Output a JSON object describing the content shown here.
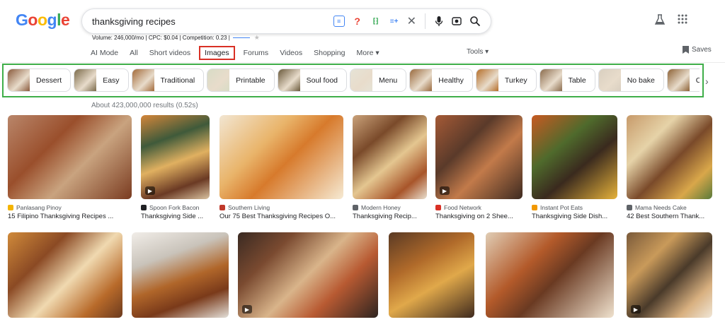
{
  "logo": {
    "letters": [
      "G",
      "o",
      "o",
      "g",
      "l",
      "e"
    ],
    "colors": [
      "#4285F4",
      "#EA4335",
      "#FBBC05",
      "#4285F4",
      "#34A853",
      "#EA4335"
    ]
  },
  "search": {
    "query": "thanksgiving recipes"
  },
  "seo": {
    "text": "Volume: 246,000/mo | CPC: $0.04 | Competition: 0.23 |"
  },
  "tabs": [
    {
      "label": "AI Mode"
    },
    {
      "label": "All"
    },
    {
      "label": "Short videos"
    },
    {
      "label": "Images",
      "active": true
    },
    {
      "label": "Forums"
    },
    {
      "label": "Videos"
    },
    {
      "label": "Shopping"
    },
    {
      "label": "More ▾"
    }
  ],
  "tools_label": "Tools ▾",
  "saves_label": "Saves",
  "chips": [
    {
      "label": "Dessert",
      "color": "#8a5a3c"
    },
    {
      "label": "Easy",
      "color": "#7b6a4a"
    },
    {
      "label": "Traditional",
      "color": "#a36a3a"
    },
    {
      "label": "Printable",
      "color": "#d8dcc6"
    },
    {
      "label": "Soul food",
      "color": "#6b5a3c"
    },
    {
      "label": "Menu",
      "color": "#e6e3d6"
    },
    {
      "label": "Healthy",
      "color": "#9a6a3e"
    },
    {
      "label": "Turkey",
      "color": "#b56e2a"
    },
    {
      "label": "Table",
      "color": "#8b6c4d"
    },
    {
      "label": "No bake",
      "color": "#d9cfc0"
    },
    {
      "label": "Chicken",
      "color": "#8d6236"
    }
  ],
  "results_count": "About 423,000,000 results (0.52s)",
  "row1": [
    {
      "source": "Panlasang Pinoy",
      "title": "15 Filipino Thanksgiving Recipes ...",
      "fav": "#f4b400",
      "bg": "linear-gradient(135deg,#b9866a 0%,#9a4f2c 35%,#c9a37f 60%,#7a3b20 100%)"
    },
    {
      "source": "Spoon Fork Bacon",
      "title": "Thanksgiving Side ...",
      "fav": "#202124",
      "video": true,
      "bg": "linear-gradient(160deg,#d4863a 0%,#3f5a3a 30%,#e0b060 55%,#6b3a24 80%,#d9c2a0 100%)"
    },
    {
      "source": "Southern Living",
      "title": "Our 75 Best Thanksgiving Recipes O...",
      "fav": "#c0392b",
      "bg": "linear-gradient(135deg,#f2e6d2 0%,#e9b46a 35%,#d77a2c 55%,#f6ead3 100%)"
    },
    {
      "source": "Modern Honey",
      "title": "Thanksgiving Recip...",
      "fav": "#5f6368",
      "bg": "linear-gradient(140deg,#caa27a 0%,#7a4a2a 30%,#e4c690 55%,#a8552a 80%,#e9dfcf 100%)"
    },
    {
      "source": "Food Network",
      "title": "Thanksgiving on 2 Shee...",
      "fav": "#d93025",
      "video": true,
      "bg": "linear-gradient(135deg,#a55a36 0%,#5a3a2a 35%,#c27a4a 60%,#3e2a20 100%)"
    },
    {
      "source": "Instant Pot Eats",
      "title": "Thanksgiving Side Dish...",
      "fav": "#f29900",
      "bg": "linear-gradient(140deg,#c75a22 0%,#4f6a2c 35%,#3a2a1e 60%,#e6b23a 100%)"
    },
    {
      "source": "Mama Needs Cake",
      "title": "42 Best Southern Thank...",
      "fav": "#5f6368",
      "bg": "linear-gradient(135deg,#c79a6a 0%,#e6d3a8 30%,#7a4a2a 55%,#d9a74a 80%,#5a7a3a 100%)"
    }
  ],
  "row2": [
    {
      "bg": "linear-gradient(135deg,#d08a3a 0%,#8b4a24 30%,#f0d9b0 55%,#b86a2a 80%,#6b3a1e 100%)"
    },
    {
      "bg": "linear-gradient(160deg,#f1ede8 0%,#c9c3ba 30%,#b0662a 55%,#7a3a1a 75%,#e3dfd8 100%)"
    },
    {
      "bg": "linear-gradient(135deg,#3a2a22 0%,#7a4a30 25%,#d9b48a 50%,#b85a32 70%,#2e2420 100%)",
      "video": true
    },
    {
      "bg": "linear-gradient(150deg,#5a3a24 0%,#b06a2a 35%,#e0a84a 60%,#3f2a1e 100%)"
    },
    {
      "bg": "linear-gradient(135deg,#e0cdb5 0%,#b35a2a 35%,#6a3a22 55%,#f0e2ce 100%)"
    },
    {
      "bg": "linear-gradient(135deg,#7a5a3a 0%,#c99a5a 30%,#4a3a2a 55%,#d8b080 80%,#f0e6d6 100%)",
      "video": true
    }
  ]
}
